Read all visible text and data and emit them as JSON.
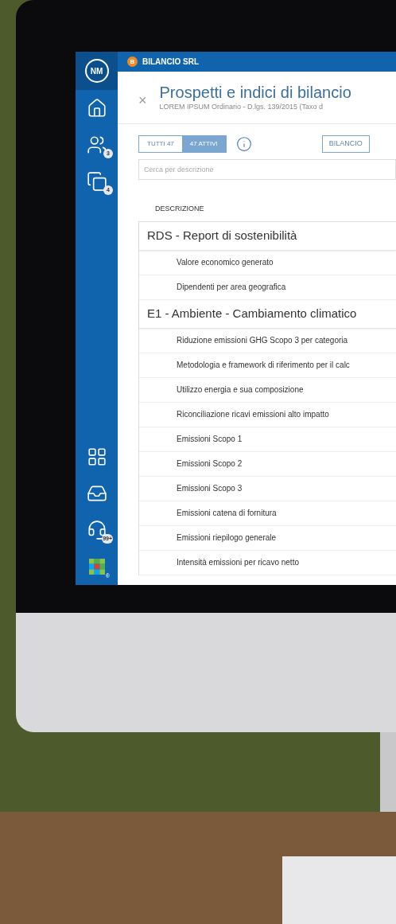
{
  "company": {
    "initial": "B",
    "name": "BILANCIO SRL"
  },
  "sidebar": {
    "avatar": "NM",
    "items": [
      {
        "kind": "home"
      },
      {
        "kind": "users",
        "badge": "3"
      },
      {
        "kind": "windows",
        "badge": "4"
      }
    ],
    "bottom_items": [
      {
        "kind": "grid"
      },
      {
        "kind": "inbox"
      },
      {
        "kind": "headset",
        "badge": "99+"
      },
      {
        "kind": "logo",
        "badge": "®"
      }
    ]
  },
  "header": {
    "close": "×",
    "title": "Prospetti e indici di bilancio",
    "subtitle": "LOREM IPSUM Ordinario - D.lgs. 139/2015 (Taxo d"
  },
  "tabs": [
    {
      "label": "TUTTI 47",
      "selected": false
    },
    {
      "label": "47 ATTIVI",
      "selected": true
    }
  ],
  "filter_button": "BILANCIO",
  "search": {
    "placeholder": "Cerca per descrizione"
  },
  "table": {
    "column": "DESCRIZIONE",
    "rows": [
      {
        "kind": "group",
        "label": "RDS - Report di sostenibilità"
      },
      {
        "kind": "item",
        "label": "Valore economico generato"
      },
      {
        "kind": "item",
        "label": "Dipendenti per area geografica"
      },
      {
        "kind": "group",
        "label": "E1 - Ambiente - Cambiamento climatico"
      },
      {
        "kind": "item",
        "label": "Riduzione emissioni GHG Scopo 3 per categoria"
      },
      {
        "kind": "item",
        "label": "Metodologia e framework di riferimento per il calc"
      },
      {
        "kind": "item",
        "label": "Utilizzo energia e sua composizione"
      },
      {
        "kind": "item",
        "label": "Riconciliazione ricavi emissioni alto impatto"
      },
      {
        "kind": "item",
        "label": "Emissioni Scopo 1"
      },
      {
        "kind": "item",
        "label": "Emissioni Scopo 2"
      },
      {
        "kind": "item",
        "label": "Emissioni Scopo 3"
      },
      {
        "kind": "item",
        "label": "Emissioni catena di fornitura"
      },
      {
        "kind": "item",
        "label": "Emissioni riepilogo generale"
      },
      {
        "kind": "item",
        "label": "Intensità emissioni per ricavo netto"
      }
    ]
  }
}
